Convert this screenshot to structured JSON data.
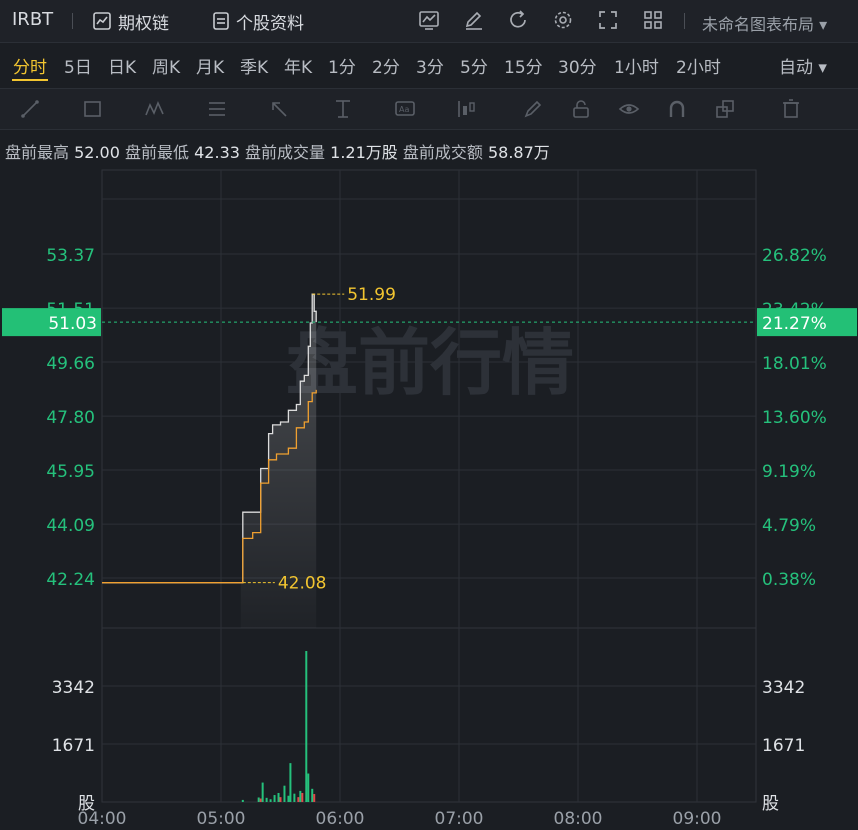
{
  "header": {
    "ticker": "IRBT",
    "option_chain": "期权链",
    "profile": "个股资料",
    "layout": "未命名图表布局"
  },
  "timeframes": [
    {
      "label": "分时",
      "active": true
    },
    {
      "label": "5日"
    },
    {
      "label": "日K"
    },
    {
      "label": "周K"
    },
    {
      "label": "月K"
    },
    {
      "label": "季K"
    },
    {
      "label": "年K"
    },
    {
      "label": "1分"
    },
    {
      "label": "2分"
    },
    {
      "label": "3分"
    },
    {
      "label": "5分"
    },
    {
      "label": "15分"
    },
    {
      "label": "30分"
    },
    {
      "label": "1小时"
    },
    {
      "label": "2小时"
    }
  ],
  "auto_label": "自动",
  "premarket": {
    "high_label": "盘前最高",
    "high": "52.00",
    "low_label": "盘前最低",
    "low": "42.33",
    "volume_label": "盘前成交量",
    "volume": "1.21万股",
    "amount_label": "盘前成交额",
    "amount": "58.87万"
  },
  "chart_data": {
    "type": "line",
    "watermark": "盘前行情",
    "x_ticks": [
      "04:00",
      "05:00",
      "06:00",
      "07:00",
      "08:00",
      "09:00"
    ],
    "price_ticks": [
      "53.37",
      "51.51",
      "49.66",
      "47.80",
      "45.95",
      "44.09",
      "42.24"
    ],
    "pct_ticks": [
      "26.82%",
      "23.42%",
      "18.01%",
      "13.60%",
      "9.19%",
      "4.79%",
      "0.38%"
    ],
    "volume_ticks": [
      "3342",
      "1671"
    ],
    "volume_unit": "股",
    "current_price": "51.03",
    "current_pct": "21.27%",
    "high_marker": "51.99",
    "low_marker": "42.08",
    "colors": {
      "up": "#25c17c",
      "down": "#e04a4a",
      "price": "#dcdcdc",
      "avg": "#f0a030",
      "marker": "#f2c530",
      "badge": "#23c076"
    },
    "price_series": [
      [
        "04:00",
        42.08
      ],
      [
        "05:10",
        42.08
      ],
      [
        "05:11",
        44.5
      ],
      [
        "05:18",
        44.5
      ],
      [
        "05:20",
        46.0
      ],
      [
        "05:24",
        47.2
      ],
      [
        "05:26",
        47.5
      ],
      [
        "05:30",
        47.6
      ],
      [
        "05:34",
        48.0
      ],
      [
        "05:38",
        48.2
      ],
      [
        "05:40",
        49.0
      ],
      [
        "05:42",
        49.2
      ],
      [
        "05:44",
        50.2
      ],
      [
        "05:45",
        51.0
      ],
      [
        "05:46",
        51.99
      ],
      [
        "05:47",
        51.4
      ],
      [
        "05:48",
        51.03
      ]
    ],
    "avg_series": [
      [
        "04:00",
        42.08
      ],
      [
        "05:10",
        42.08
      ],
      [
        "05:11",
        43.6
      ],
      [
        "05:16",
        43.8
      ],
      [
        "05:18",
        43.8
      ],
      [
        "05:20",
        45.5
      ],
      [
        "05:24",
        46.3
      ],
      [
        "05:28",
        46.5
      ],
      [
        "05:34",
        46.7
      ],
      [
        "05:38",
        47.4
      ],
      [
        "05:42",
        47.6
      ],
      [
        "05:44",
        48.3
      ],
      [
        "05:46",
        48.6
      ],
      [
        "05:48",
        48.7
      ]
    ],
    "volume_series": [
      [
        "05:11",
        60,
        "up"
      ],
      [
        "05:19",
        130,
        "up"
      ],
      [
        "05:20",
        100,
        "down"
      ],
      [
        "05:21",
        560,
        "up"
      ],
      [
        "05:23",
        120,
        "up"
      ],
      [
        "05:25",
        80,
        "up"
      ],
      [
        "05:27",
        200,
        "up"
      ],
      [
        "05:29",
        260,
        "up"
      ],
      [
        "05:30",
        140,
        "down"
      ],
      [
        "05:32",
        470,
        "up"
      ],
      [
        "05:34",
        180,
        "up"
      ],
      [
        "05:35",
        1120,
        "up"
      ],
      [
        "05:37",
        240,
        "up"
      ],
      [
        "05:39",
        140,
        "down"
      ],
      [
        "05:40",
        320,
        "up"
      ],
      [
        "05:41",
        260,
        "down"
      ],
      [
        "05:43",
        4350,
        "up"
      ],
      [
        "05:44",
        820,
        "up"
      ],
      [
        "05:46",
        380,
        "up"
      ],
      [
        "05:47",
        230,
        "down"
      ]
    ]
  }
}
